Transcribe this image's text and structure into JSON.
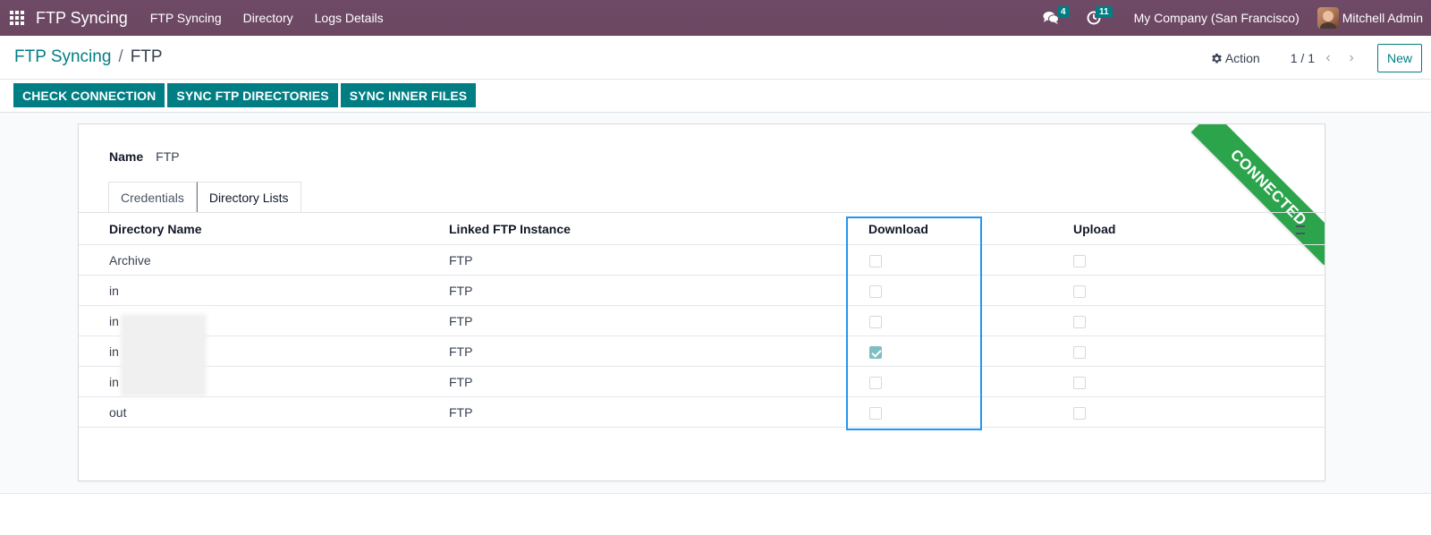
{
  "navbar": {
    "brand": "FTP Syncing",
    "menu": [
      "FTP Syncing",
      "Directory",
      "Logs Details"
    ],
    "messages_count": "4",
    "activities_count": "11",
    "company": "My Company (San Francisco)",
    "user": "Mitchell Admin"
  },
  "control_panel": {
    "breadcrumb_parent": "FTP Syncing",
    "breadcrumb_sep": "/",
    "breadcrumb_current": "FTP",
    "action_label": "Action",
    "pager": "1 / 1",
    "new_label": "New",
    "buttons": [
      "CHECK CONNECTION",
      "SYNC FTP DIRECTORIES",
      "SYNC INNER FILES"
    ]
  },
  "form": {
    "ribbon": "CONNECTED",
    "name_label": "Name",
    "name_value": "FTP",
    "tabs": [
      "Credentials",
      "Directory Lists"
    ],
    "active_tab": "Directory Lists"
  },
  "list": {
    "headers": [
      "Directory Name",
      "Linked FTP Instance",
      "Download",
      "Upload"
    ],
    "rows": [
      {
        "name": "Archive",
        "instance": "FTP",
        "download": false,
        "upload": false
      },
      {
        "name": "in",
        "instance": "FTP",
        "download": false,
        "upload": false
      },
      {
        "name": "in",
        "instance": "FTP",
        "download": false,
        "upload": false
      },
      {
        "name": "in",
        "instance": "FTP",
        "download": true,
        "upload": false
      },
      {
        "name": "in",
        "instance": "FTP",
        "download": false,
        "upload": false
      },
      {
        "name": "out",
        "instance": "FTP",
        "download": false,
        "upload": false
      }
    ]
  },
  "colors": {
    "navbar": "#714b67",
    "primary": "#017e84",
    "ribbon": "#28a745",
    "highlight": "#2196f3"
  }
}
